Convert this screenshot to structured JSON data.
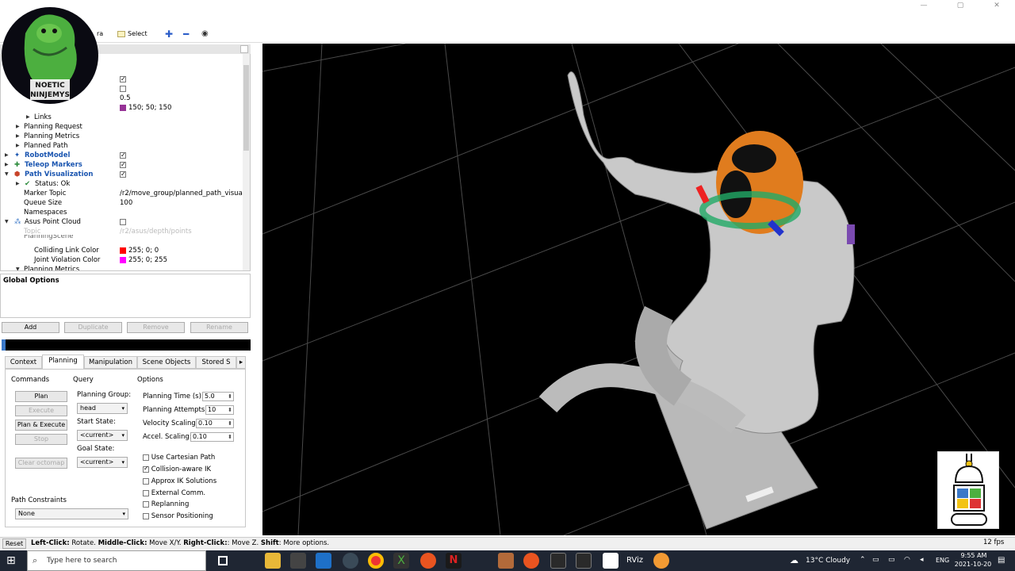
{
  "window": {
    "minimize": "—",
    "maximize": "▢",
    "close": "✕"
  },
  "toolbar": {
    "partial_label": "ra",
    "select_label": "Select"
  },
  "logo_text": {
    "line1": "NOETIC",
    "line2": "NINJEMYS"
  },
  "tree": {
    "alpha_value": "0.5",
    "color_value": "150; 50; 150",
    "links": "Links",
    "planning_request": "Planning Request",
    "planning_metrics": "Planning Metrics",
    "planned_path": "Planned Path",
    "robot_model": "RobotModel",
    "teleop_markers": "Teleop Markers",
    "path_visualization": "Path Visualization",
    "status": "Status: Ok",
    "marker_topic_label": "Marker Topic",
    "marker_topic_value": "/r2/move_group/planned_path_visua...",
    "queue_size_label": "Queue Size",
    "queue_size_value": "100",
    "namespaces": "Namespaces",
    "asus_point_cloud": "Asus Point Cloud",
    "topic_label": "Topic",
    "topic_value": "/r2/asus/depth/points",
    "planning_scene_partial": "PlanningScene",
    "colliding_link_label": "Colliding Link Color",
    "colliding_link_value": "255; 0; 0",
    "joint_violation_label": "Joint Violation Color",
    "joint_violation_value": "255; 0; 255",
    "planning_metrics2": "Planning Metrics"
  },
  "colors": {
    "purple": "#963296",
    "red": "#ff0000",
    "magenta": "#ff00ff",
    "orange": "#e8821e"
  },
  "description": {
    "title": "Global Options"
  },
  "buttons": {
    "add": "Add",
    "duplicate": "Duplicate",
    "remove": "Remove",
    "rename": "Rename"
  },
  "tabs": [
    "Context",
    "Planning",
    "Manipulation",
    "Scene Objects",
    "Stored S"
  ],
  "tab_more": "▸",
  "planning": {
    "commands_header": "Commands",
    "query_header": "Query",
    "options_header": "Options",
    "plan": "Plan",
    "execute": "Execute",
    "plan_execute": "Plan & Execute",
    "stop": "Stop",
    "clear_octomap": "Clear octomap",
    "planning_group_label": "Planning Group:",
    "planning_group_value": "head",
    "start_state_label": "Start State:",
    "start_state_value": "<current>",
    "goal_state_label": "Goal State:",
    "goal_state_value": "<current>",
    "planning_time_label": "Planning Time (s):",
    "planning_time_value": "5.0",
    "planning_attempts_label": "Planning Attempts:",
    "planning_attempts_value": "10",
    "velocity_scaling_label": "Velocity Scaling:",
    "velocity_scaling_value": "0.10",
    "accel_scaling_label": "Accel. Scaling:",
    "accel_scaling_value": "0.10",
    "use_cartesian": "Use Cartesian Path",
    "collision_aware": "Collision-aware IK",
    "approx_ik": "Approx IK Solutions",
    "external_comm": "External Comm.",
    "replanning": "Replanning",
    "sensor_positioning": "Sensor Positioning",
    "path_constraints_label": "Path Constraints",
    "path_constraints_value": "None"
  },
  "status": {
    "reset": "Reset",
    "left_click": "Left-Click:",
    "left_click_desc": " Rotate. ",
    "middle_click": "Middle-Click:",
    "middle_click_desc": " Move X/Y. ",
    "right_click": "Right-Click:",
    "right_click_desc": ": Move Z. ",
    "shift": "Shift",
    "shift_desc": ": More options.",
    "fps": "12 fps"
  },
  "taskbar": {
    "search_placeholder": "Type here to search",
    "weather": "13°C  Cloudy",
    "lang": "ENG",
    "time": "9:55 AM",
    "date": "2021-10-20"
  }
}
